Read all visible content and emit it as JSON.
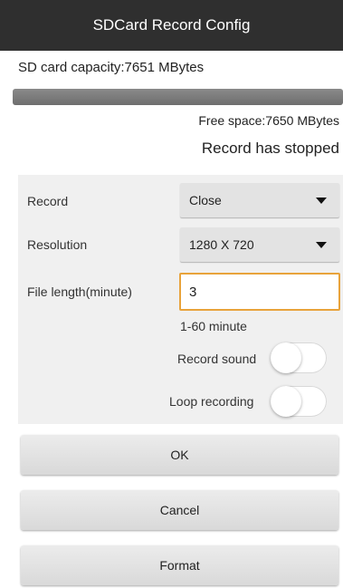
{
  "title": "SDCard Record Config",
  "storage": {
    "capacity_text": "SD card capacity:7651 MBytes",
    "used_fraction": 0.9999,
    "free_space_text": "Free space:7650 MBytes",
    "record_status": "Record has stopped"
  },
  "form": {
    "record_label": "Record",
    "record_value": "Close",
    "resolution_label": "Resolution",
    "resolution_value": "1280 X 720",
    "file_length_label": "File length(minute)",
    "file_length_value": "3",
    "file_length_hint": "1-60 minute",
    "record_sound_label": "Record sound",
    "record_sound_on": false,
    "loop_recording_label": "Loop recording",
    "loop_recording_on": false
  },
  "buttons": {
    "ok": "OK",
    "cancel": "Cancel",
    "format": "Format"
  },
  "colors": {
    "titlebar": "#2f2f2f",
    "input_focus_border": "#e8a33b",
    "panel": "#f0f0f0"
  }
}
